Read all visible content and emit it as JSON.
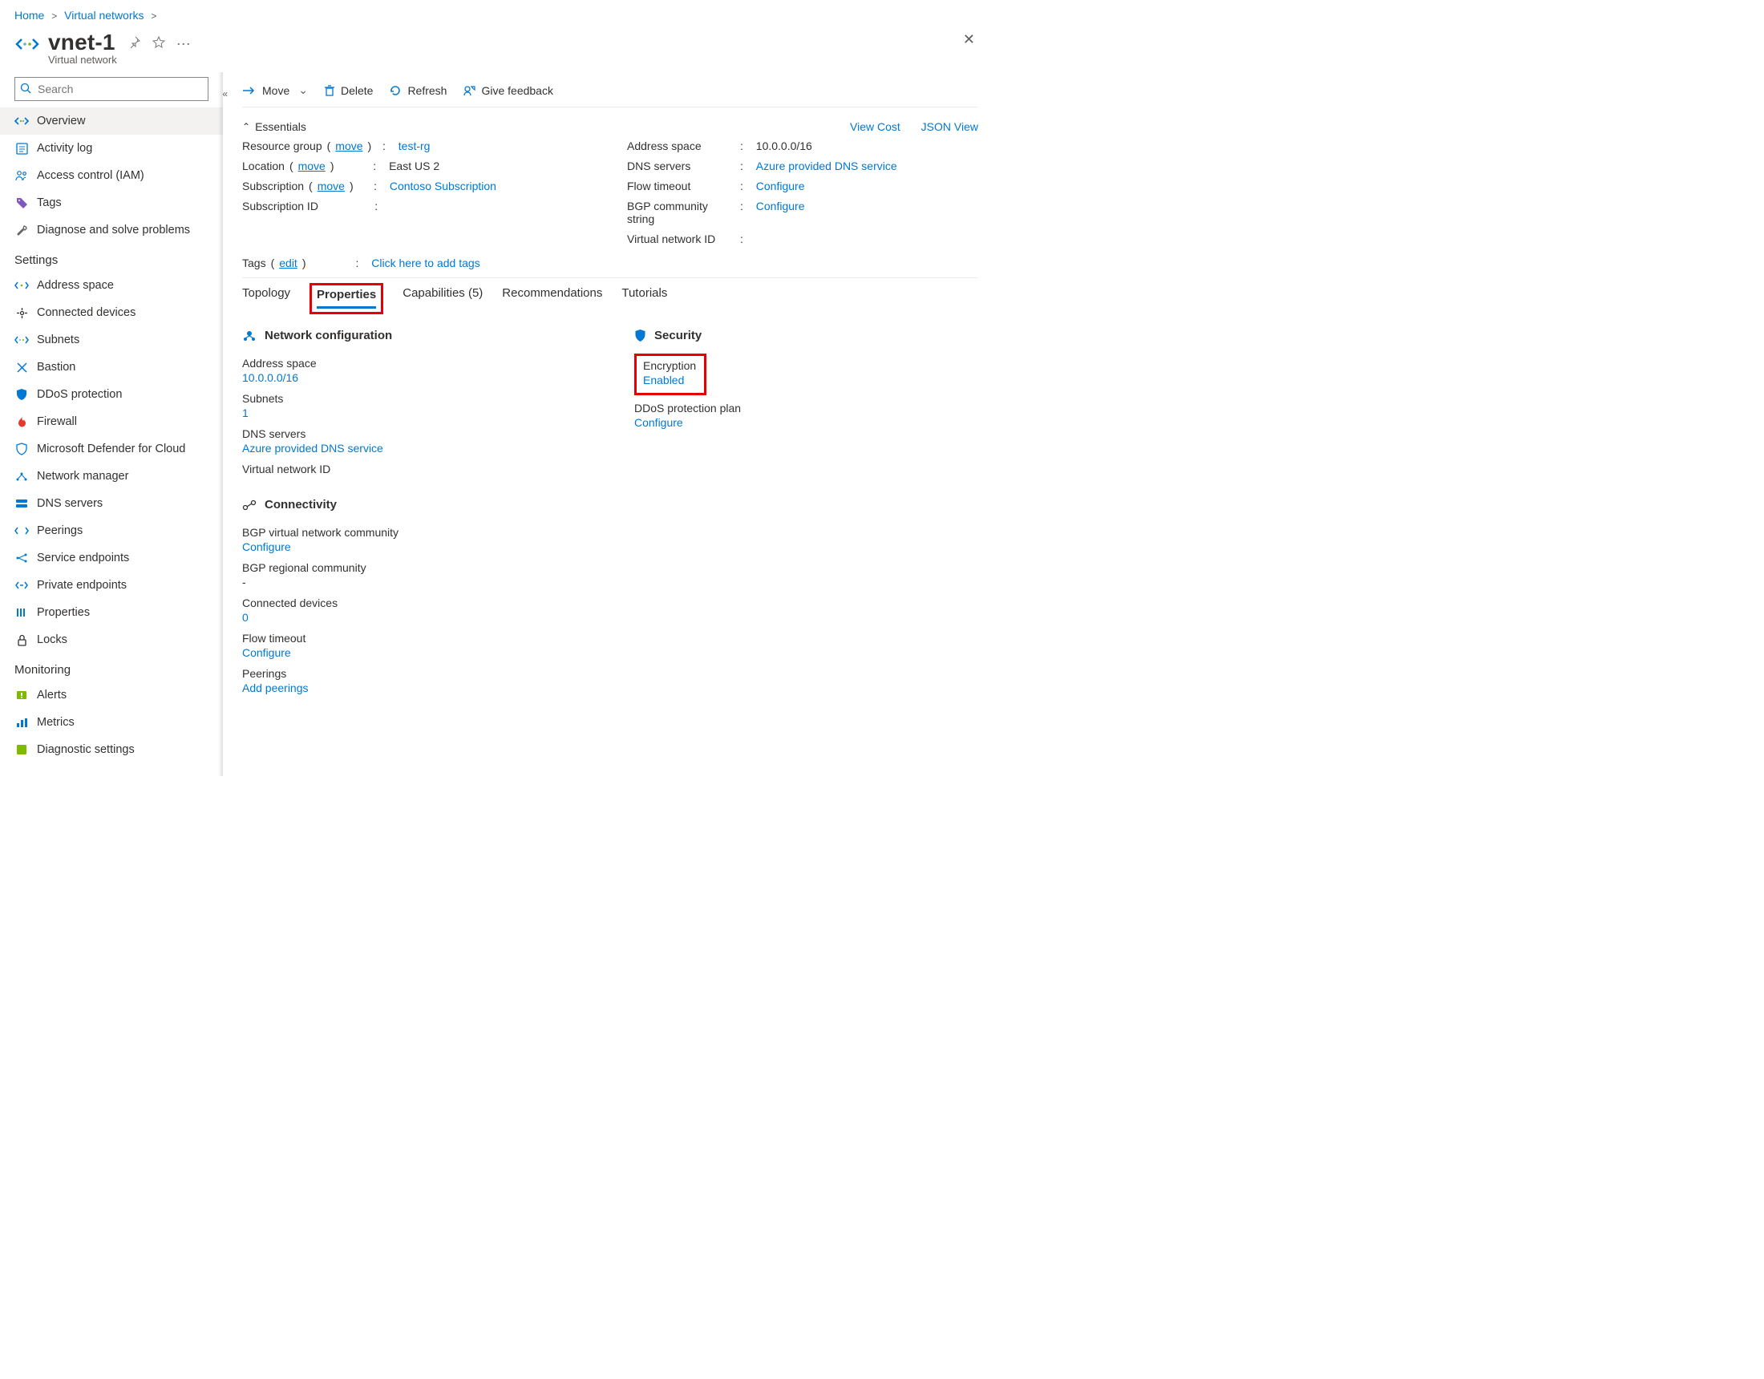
{
  "breadcrumbs": {
    "home": "Home",
    "vnets": "Virtual networks"
  },
  "page": {
    "title": "vnet-1",
    "subtitle": "Virtual network"
  },
  "search": {
    "placeholder": "Search"
  },
  "nav": {
    "overview": "Overview",
    "activity": "Activity log",
    "iam": "Access control (IAM)",
    "tags": "Tags",
    "diagnose": "Diagnose and solve problems",
    "settings_label": "Settings",
    "address_space": "Address space",
    "connected_devices": "Connected devices",
    "subnets": "Subnets",
    "bastion": "Bastion",
    "ddos": "DDoS protection",
    "firewall": "Firewall",
    "defender": "Microsoft Defender for Cloud",
    "network_manager": "Network manager",
    "dns_servers": "DNS servers",
    "peerings": "Peerings",
    "service_endpoints": "Service endpoints",
    "private_endpoints": "Private endpoints",
    "properties": "Properties",
    "locks": "Locks",
    "monitoring_label": "Monitoring",
    "alerts": "Alerts",
    "metrics": "Metrics",
    "diag_settings": "Diagnostic settings"
  },
  "toolbar": {
    "move": "Move",
    "delete": "Delete",
    "refresh": "Refresh",
    "feedback": "Give feedback"
  },
  "essentials": {
    "header": "Essentials",
    "view_cost": "View Cost",
    "json_view": "JSON View",
    "rg_label": "Resource group",
    "rg_move": "move",
    "rg_value": "test-rg",
    "loc_label": "Location",
    "loc_move": "move",
    "loc_value": "East US 2",
    "sub_label": "Subscription",
    "sub_move": "move",
    "sub_value": "Contoso Subscription",
    "subid_label": "Subscription ID",
    "addr_label": "Address space",
    "addr_value": "10.0.0.0/16",
    "dns_label": "DNS servers",
    "dns_value": "Azure provided DNS service",
    "flow_label": "Flow timeout",
    "flow_value": "Configure",
    "bgp_label": "BGP community string",
    "bgp_value": "Configure",
    "vnetid_label": "Virtual network ID"
  },
  "tags": {
    "label": "Tags",
    "edit": "edit",
    "add": "Click here to add tags"
  },
  "tabs": {
    "topology": "Topology",
    "properties": "Properties",
    "capabilities": "Capabilities (5)",
    "recommendations": "Recommendations",
    "tutorials": "Tutorials"
  },
  "netconf": {
    "title": "Network configuration",
    "addr_label": "Address space",
    "addr_value": "10.0.0.0/16",
    "subnets_label": "Subnets",
    "subnets_value": "1",
    "dns_label": "DNS servers",
    "dns_value": "Azure provided DNS service",
    "vnetid_label": "Virtual network ID"
  },
  "security": {
    "title": "Security",
    "enc_label": "Encryption",
    "enc_value": "Enabled",
    "ddos_label": "DDoS protection plan",
    "ddos_value": "Configure"
  },
  "connectivity": {
    "title": "Connectivity",
    "bgp_vnet_label": "BGP virtual network community",
    "bgp_vnet_value": "Configure",
    "bgp_reg_label": "BGP regional community",
    "bgp_reg_value": "-",
    "conn_dev_label": "Connected devices",
    "conn_dev_value": "0",
    "flow_label": "Flow timeout",
    "flow_value": "Configure",
    "peerings_label": "Peerings",
    "peerings_value": "Add peerings"
  }
}
